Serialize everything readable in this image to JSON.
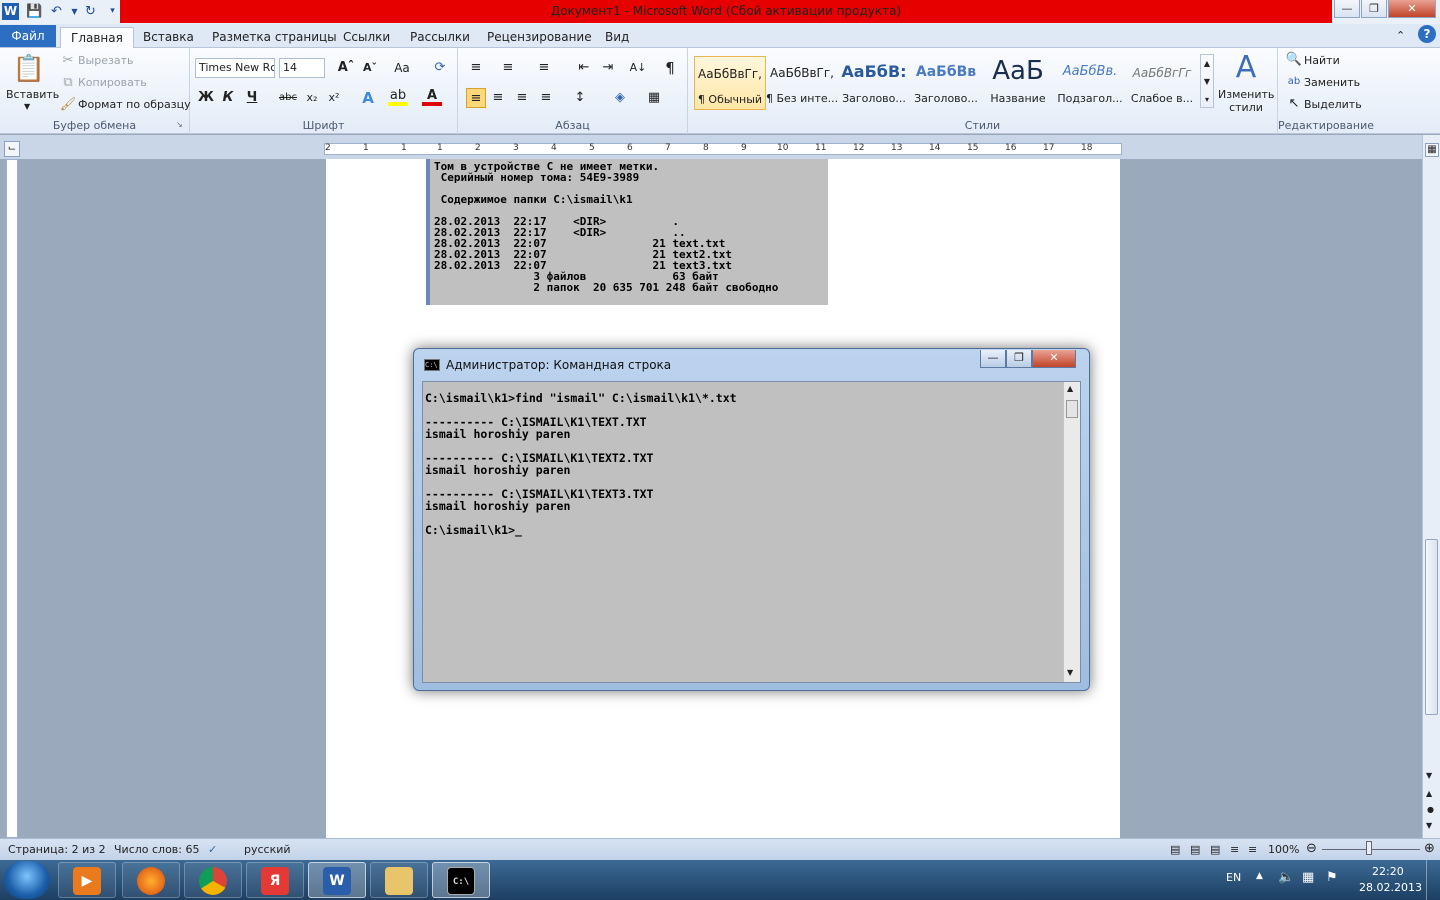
{
  "window": {
    "title": "Документ1  -  Microsoft Word (Сбой активации продукта)"
  },
  "tabs": {
    "file": "Файл",
    "items": [
      "Главная",
      "Вставка",
      "Разметка страницы",
      "Ссылки",
      "Рассылки",
      "Рецензирование",
      "Вид"
    ]
  },
  "clipboard": {
    "paste": "Вставить",
    "cut": "Вырезать",
    "copy": "Копировать",
    "format_painter": "Формат по образцу",
    "label": "Буфер обмена"
  },
  "font": {
    "name": "Times New Rc",
    "size": "14",
    "label": "Шрифт",
    "bold": "Ж",
    "italic": "К",
    "underline": "Ч",
    "strike": "abc",
    "sub": "x₂",
    "sup": "x²",
    "grow": "A^",
    "shrink": "A˅",
    "case": "Aa"
  },
  "paragraph": {
    "label": "Абзац",
    "pilcrow": "¶"
  },
  "styles": {
    "label": "Стили",
    "items": [
      {
        "sample": "АаБбВвГг,",
        "name": "¶ Обычный"
      },
      {
        "sample": "АаБбВвГг,",
        "name": "¶ Без инте..."
      },
      {
        "sample": "АаБбВ:",
        "name": "Заголово..."
      },
      {
        "sample": "АаБбВв",
        "name": "Заголово..."
      },
      {
        "sample": "АаБ",
        "name": "Название"
      },
      {
        "sample": "АаБбВв.",
        "name": "Подзагол..."
      },
      {
        "sample": "АаБбВгГг",
        "name": "Слабое в..."
      }
    ],
    "change_styles": "Изменить стили"
  },
  "editing": {
    "label": "Редактирование",
    "find": "Найти",
    "replace": "Заменить",
    "select": "Выделить"
  },
  "ruler": {
    "numbers": [
      "2",
      "1",
      "1",
      "1",
      "2",
      "3",
      "4",
      "5",
      "6",
      "7",
      "8",
      "9",
      "10",
      "11",
      "12",
      "13",
      "14",
      "15",
      "16",
      "17",
      "18"
    ]
  },
  "embedded_screenshot": {
    "text": "Том в устройстве C не имеет метки.\n Серийный номер тома: 54E9-3989\n\n Содержимое папки C:\\ismail\\k1\n\n28.02.2013  22:17    <DIR>          .\n28.02.2013  22:17    <DIR>          ..\n28.02.2013  22:07                21 text.txt\n28.02.2013  22:07                21 text2.txt\n28.02.2013  22:07                21 text3.txt\n               3 файлов             63 байт\n               2 папок  20 635 701 248 байт свободно"
  },
  "cmd": {
    "title": "Администратор: Командная строка",
    "output": "C:\\ismail\\k1>find \"ismail\" C:\\ismail\\k1\\*.txt\n\n---------- C:\\ISMAIL\\K1\\TEXT.TXT\nismail horoshiy paren\n\n---------- C:\\ISMAIL\\K1\\TEXT2.TXT\nismail horoshiy paren\n\n---------- C:\\ISMAIL\\K1\\TEXT3.TXT\nismail horoshiy paren\n\nC:\\ismail\\k1>_"
  },
  "status": {
    "page": "Страница: 2 из 2",
    "words": "Число слов: 65",
    "language": "русский",
    "zoom": "100%"
  },
  "taskbar": {
    "lang": "EN",
    "time": "22:20",
    "date": "28.02.2013"
  },
  "colors": {
    "title_bar_error": "#e60000",
    "file_tab": "#2b6ec2"
  }
}
